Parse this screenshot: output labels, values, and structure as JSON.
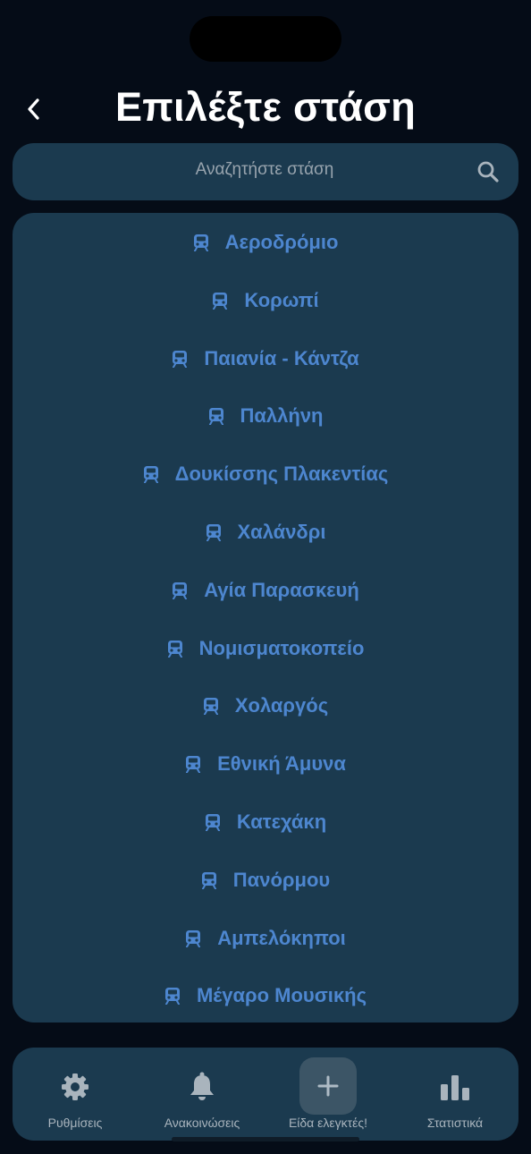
{
  "header": {
    "title": "Επιλέξτε στάση"
  },
  "search": {
    "placeholder": "Αναζητήστε στάση"
  },
  "stops": [
    "Αεροδρόμιο",
    "Κορωπί",
    "Παιανία - Κάντζα",
    "Παλλήνη",
    "Δουκίσσης Πλακεντίας",
    "Χαλάνδρι",
    "Αγία Παρασκευή",
    "Νομισματοκοπείο",
    "Χολαργός",
    "Εθνική Άμυνα",
    "Κατεχάκη",
    "Πανόρμου",
    "Αμπελόκηποι",
    "Μέγαρο Μουσικής"
  ],
  "stop_icon": "train-icon",
  "tabbar": {
    "settings": {
      "label": "Ρυθμίσεις",
      "icon": "gear-icon"
    },
    "announcements": {
      "label": "Ανακοινώσεις",
      "icon": "bell-icon"
    },
    "report": {
      "label": "Είδα ελεγκτές!",
      "icon": "plus-icon"
    },
    "stats": {
      "label": "Στατιστικά",
      "icon": "bar-chart-icon"
    }
  },
  "colors": {
    "background": "#050c17",
    "panel": "#1b3a4f",
    "accent": "#4d86cf",
    "tab_text": "#a9b4bd"
  }
}
